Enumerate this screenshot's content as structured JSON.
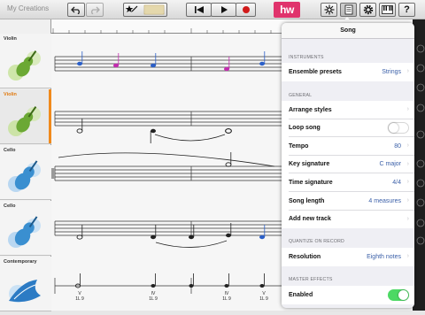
{
  "app": {
    "title": "My Creations"
  },
  "toolbar": {
    "undo": "undo-icon",
    "redo": "redo-icon",
    "tempo_icon": "star-wand-icon",
    "rewind": "skip-back-icon",
    "play": "play-icon",
    "record": "record-icon",
    "logo": "hw",
    "mixer": "mixer-icon",
    "notes": "notes-icon",
    "settings": "gear-icon",
    "keyboard": "keyboard-icon",
    "help": "?"
  },
  "tracks": [
    {
      "name": "Violin",
      "color": "#6ba834",
      "selected": false
    },
    {
      "name": "Violin",
      "color": "#6ba834",
      "selected": true
    },
    {
      "name": "Cello",
      "color": "#3a8fd0",
      "selected": false
    },
    {
      "name": "Cello",
      "color": "#3a8fd0",
      "selected": false
    },
    {
      "name": "Contemporary",
      "color": "#2c7bc4",
      "selected": false
    }
  ],
  "chords": [
    {
      "numeral": "V",
      "figure": "1L 9"
    },
    {
      "numeral": "IV",
      "figure": "1L 9"
    },
    {
      "numeral": "IV",
      "figure": "1L 9"
    },
    {
      "numeral": "V",
      "figure": "1L 9"
    }
  ],
  "colors": {
    "accent": "#f08a1c",
    "toggle_on": "#4cd964",
    "value_blue": "#3a5fa8",
    "logo_pink": "#e0336c"
  },
  "song_panel": {
    "title": "Song",
    "instruments": {
      "header": "INSTRUMENTS",
      "rows": [
        {
          "label": "Ensemble presets",
          "value": "Strings"
        }
      ]
    },
    "general": {
      "header": "GENERAL",
      "arrange_styles": "Arrange styles",
      "loop_song": {
        "label": "Loop song",
        "on": false
      },
      "tempo": {
        "label": "Tempo",
        "value": "80"
      },
      "key_signature": {
        "label": "Key signature",
        "value": "C major"
      },
      "time_signature": {
        "label": "Time signature",
        "value": "4/4"
      },
      "song_length": {
        "label": "Song length",
        "value": "4 measures"
      },
      "add_new_track": "Add new track"
    },
    "quantize": {
      "header": "QUANTIZE ON RECORD",
      "resolution": {
        "label": "Resolution",
        "value": "Eighth notes"
      }
    },
    "master_effects": {
      "header": "MASTER EFFECTS",
      "enabled": {
        "label": "Enabled",
        "on": true
      }
    }
  }
}
